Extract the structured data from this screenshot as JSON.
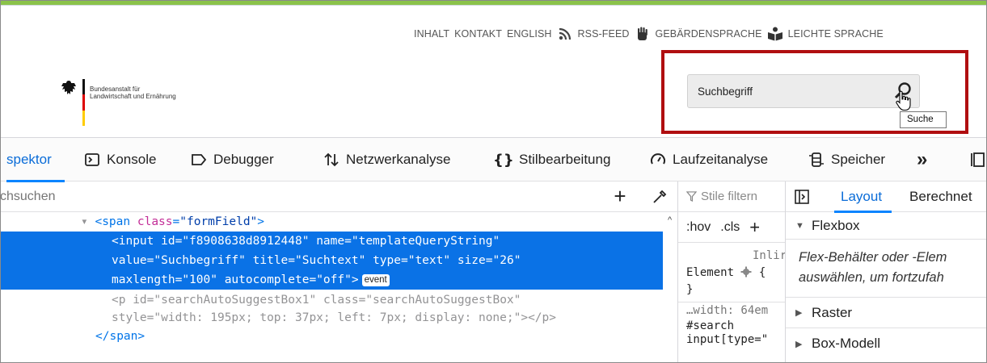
{
  "site": {
    "nav": {
      "inhalt": "INHALT",
      "kontakt": "KONTAKT",
      "english": "ENGLISH",
      "rss": "RSS-FEED",
      "sign": "GEBÄRDENSPRACHE",
      "easy": "LEICHTE SPRACHE"
    },
    "logo": {
      "line1": "Bundesanstalt für",
      "line2": "Landwirtschaft und Ernährung"
    },
    "search": {
      "value": "Suchbegriff",
      "tooltip": "Suche"
    },
    "colors": {
      "topbar": "#8bc34a",
      "highlight": "#b00e10"
    }
  },
  "devtools": {
    "tabs": {
      "inspector": "spektor",
      "console": "Konsole",
      "debugger": "Debugger",
      "network": "Netzwerkanalyse",
      "style": "Stilbearbeitung",
      "performance": "Laufzeitanalyse",
      "storage": "Speicher",
      "more": "»"
    },
    "search_placeholder": "chsuchen",
    "markup": {
      "l1_tag_open": "<span",
      "l1_attr": "class",
      "l1_val": "\"formField\"",
      "l1_close": ">",
      "l2a": "<input",
      "l2_id_n": "id",
      "l2_id_v": "\"f8908638d8912448\"",
      "l2_name_n": "name",
      "l2_name_v": "\"templateQueryString\"",
      "l3_value_n": "value",
      "l3_value_v": "\"Suchbegriff\"",
      "l3_title_n": "title",
      "l3_title_v": "\"Suchtext\"",
      "l3_type_n": "type",
      "l3_type_v": "\"text\"",
      "l3_size_n": "size",
      "l3_size_v": "\"26\"",
      "l4_max_n": "maxlength",
      "l4_max_v": "\"100\"",
      "l4_auto_n": "autocomplete",
      "l4_auto_v": "\"off\"",
      "l4_close": ">",
      "event": "event",
      "l5_open": "<p",
      "l5_id_n": "id",
      "l5_id_v": "\"searchAutoSuggestBox1\"",
      "l5_class_n": "class",
      "l5_class_v": "\"searchAutoSuggestBox\"",
      "l6_style_n": "style",
      "l6_style_v": "\"width: 195px; top: 37px; left: 7px; display: none;\"",
      "l6_close": "></p>",
      "l7": "</span>"
    },
    "rules": {
      "filter": "Stile filtern",
      "hov": ":hov",
      "cls": ".cls",
      "plus": "+",
      "inline": "Inlir",
      "element": "Element",
      "brace_open": "{",
      "brace_close": "}",
      "width": "…width: 64em",
      "sel1": "#search",
      "sel2": "input[type=\""
    },
    "layout": {
      "tab_layout": "Layout",
      "tab_computed": "Berechnet",
      "flexbox": "Flexbox",
      "flex_msg1": "Flex-Behälter oder -Elem",
      "flex_msg2": "auswählen, um fortzufah",
      "grid": "Raster",
      "boxmodel": "Box-Modell"
    }
  }
}
